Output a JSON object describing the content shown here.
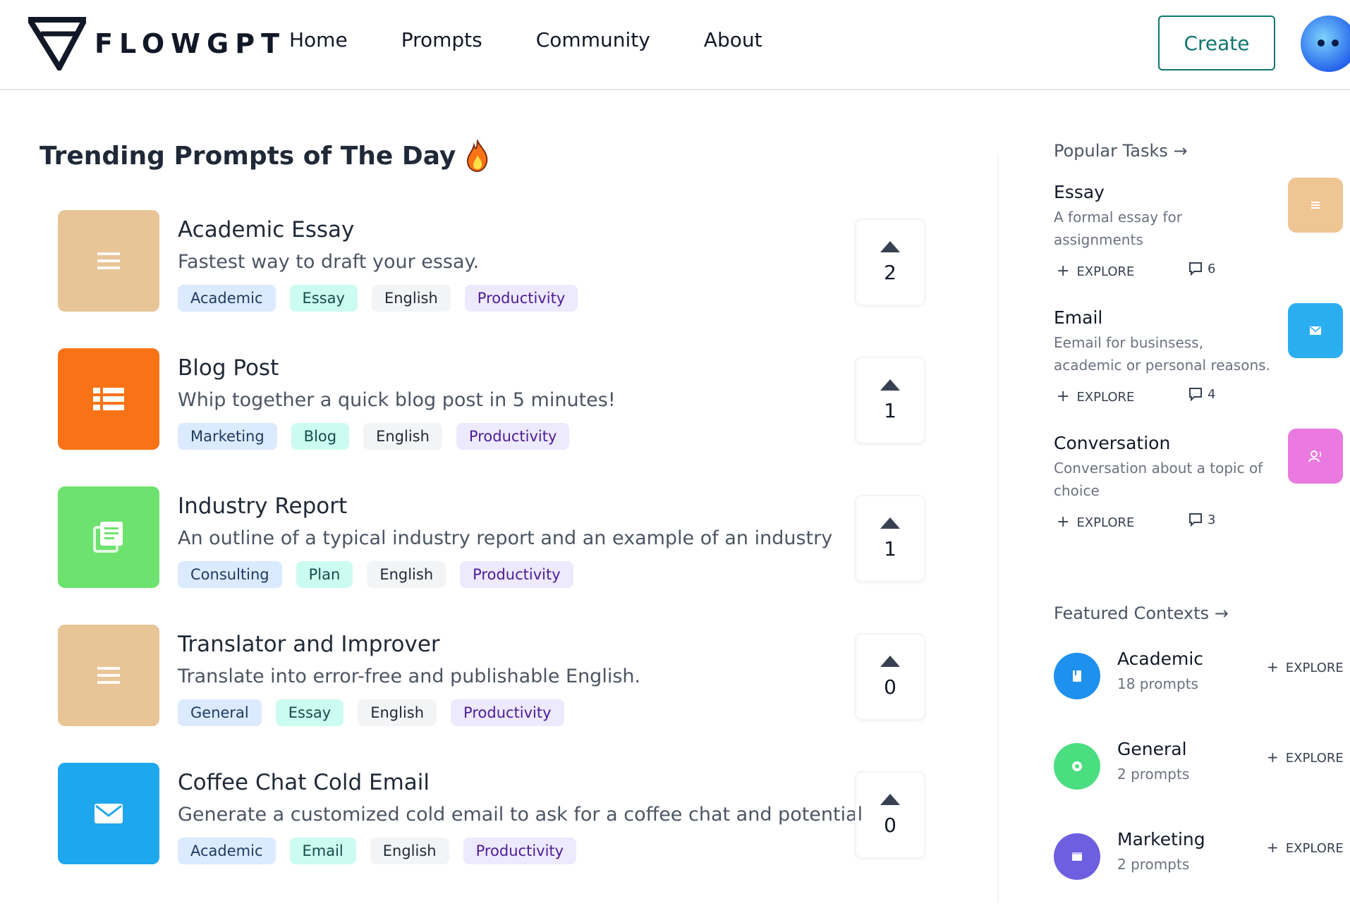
{
  "header": {
    "logo_text": "FLOWGPT",
    "nav": [
      "Home",
      "Prompts",
      "Community",
      "About"
    ],
    "create_label": "Create"
  },
  "trending": {
    "title": "Trending Prompts of The Day",
    "prompts": [
      {
        "title": "Academic Essay",
        "description": "Fastest way to draft your essay.",
        "tags": [
          "Academic",
          "Essay",
          "English",
          "Productivity"
        ],
        "votes": "2",
        "thumb_color": "#e8c596",
        "icon": "document-lines-icon"
      },
      {
        "title": "Blog Post",
        "description": "Whip together a quick blog post in 5 minutes!",
        "tags": [
          "Marketing",
          "Blog",
          "English",
          "Productivity"
        ],
        "votes": "1",
        "thumb_color": "#f97316",
        "icon": "list-icon"
      },
      {
        "title": "Industry Report",
        "description": "An outline of a typical industry report and an example of an industry",
        "tags": [
          "Consulting",
          "Plan",
          "English",
          "Productivity"
        ],
        "votes": "1",
        "thumb_color": "#6ee26e",
        "icon": "report-icon"
      },
      {
        "title": "Translator and Improver",
        "description": "Translate into error-free and publishable English.",
        "tags": [
          "General",
          "Essay",
          "English",
          "Productivity"
        ],
        "votes": "0",
        "thumb_color": "#e8c596",
        "icon": "document-lines-icon"
      },
      {
        "title": "Coffee Chat Cold Email",
        "description": "Generate a customized cold email to ask for a coffee chat and potential",
        "tags": [
          "Academic",
          "Email",
          "English",
          "Productivity"
        ],
        "votes": "0",
        "thumb_color": "#1fa7ee",
        "icon": "mail-icon"
      }
    ]
  },
  "popular_tasks": {
    "heading": "Popular Tasks →",
    "explore_label": "EXPLORE",
    "items": [
      {
        "title": "Essay",
        "description": "A formal essay for assignments",
        "comments": "6",
        "thumb_color": "#eec593"
      },
      {
        "title": "Email",
        "description": "Eemail for businsess, academic or personal reasons.",
        "comments": "4",
        "thumb_color": "#2aaef0"
      },
      {
        "title": "Conversation",
        "description": "Conversation about a topic of choice",
        "comments": "3",
        "thumb_color": "#ea79e0"
      }
    ]
  },
  "featured_contexts": {
    "heading": "Featured Contexts →",
    "explore_label": "EXPLORE",
    "items": [
      {
        "title": "Academic",
        "subtitle": "18 prompts",
        "color": "#1e90ee"
      },
      {
        "title": "General",
        "subtitle": "2 prompts",
        "color": "#4ade80"
      },
      {
        "title": "Marketing",
        "subtitle": "2 prompts",
        "color": "#6d5fe0"
      }
    ]
  }
}
